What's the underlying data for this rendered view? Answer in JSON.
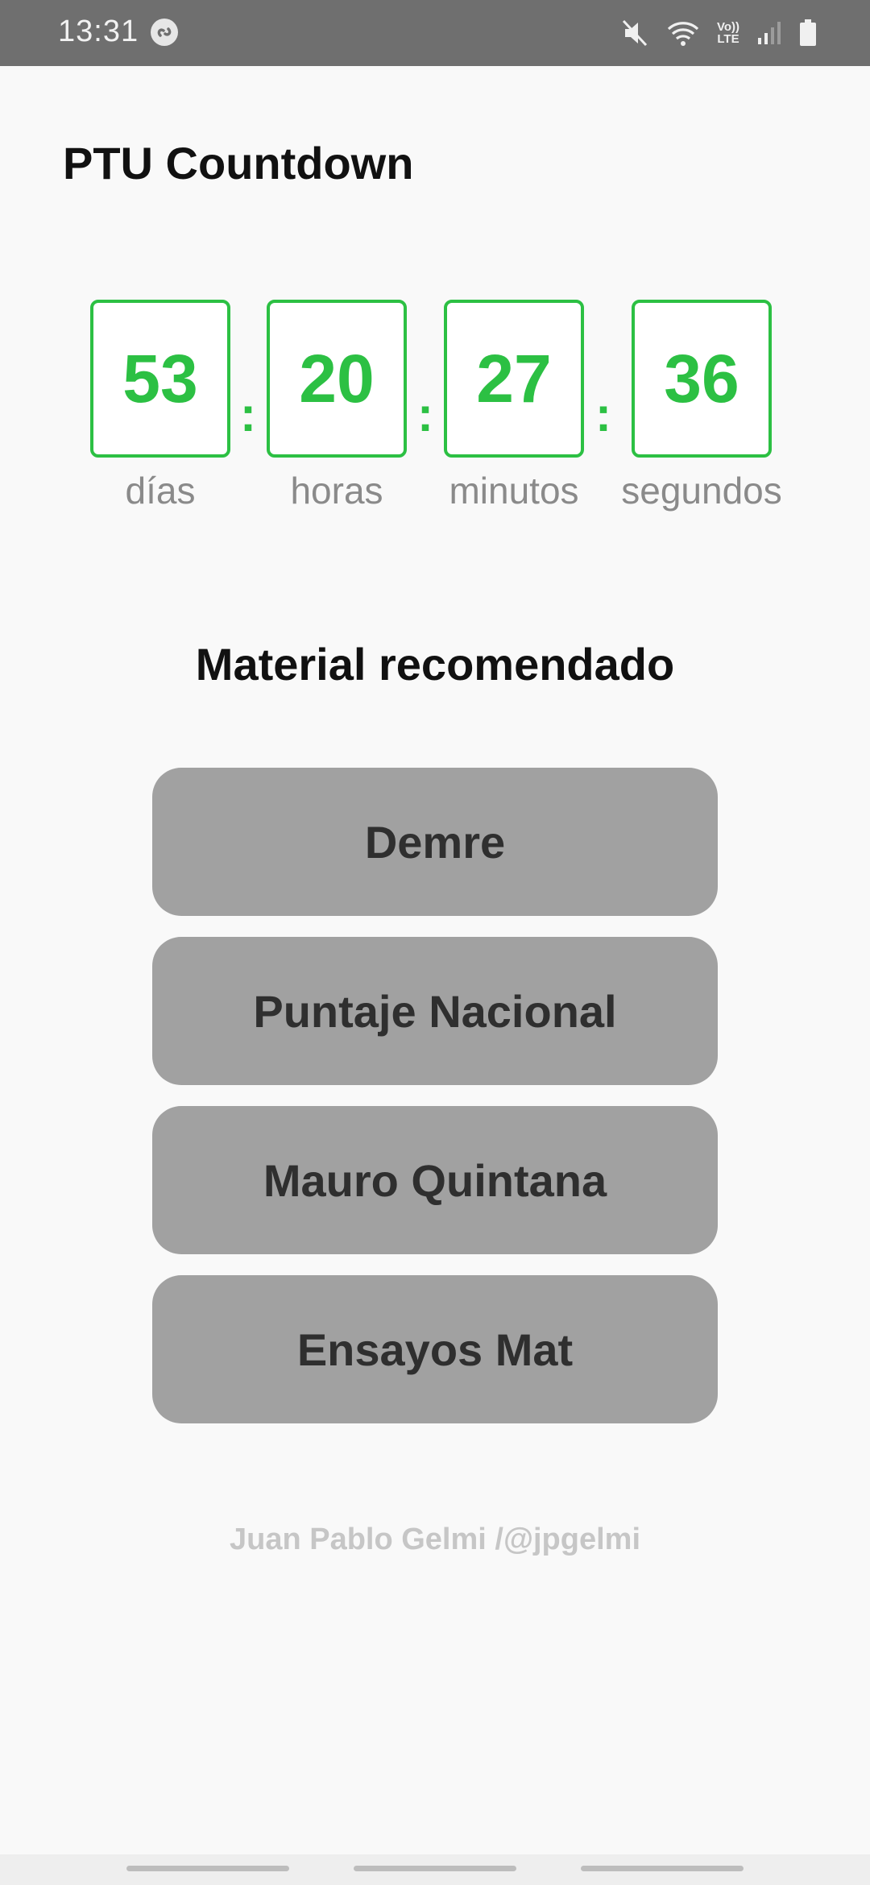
{
  "status_bar": {
    "time": "13:31",
    "lte_top": "Vo))",
    "lte_bottom": "LTE"
  },
  "app": {
    "title": "PTU Countdown"
  },
  "countdown": {
    "separator": ":",
    "units": [
      {
        "value": "53",
        "label": "días"
      },
      {
        "value": "20",
        "label": "horas"
      },
      {
        "value": "27",
        "label": "minutos"
      },
      {
        "value": "36",
        "label": "segundos"
      }
    ],
    "accent_color": "#2cc043"
  },
  "section": {
    "title": "Material recomendado"
  },
  "buttons": [
    {
      "label": "Demre"
    },
    {
      "label": "Puntaje Nacional"
    },
    {
      "label": "Mauro Quintana"
    },
    {
      "label": "Ensayos Mat"
    }
  ],
  "footer": {
    "credit": "Juan Pablo Gelmi /@jpgelmi"
  }
}
